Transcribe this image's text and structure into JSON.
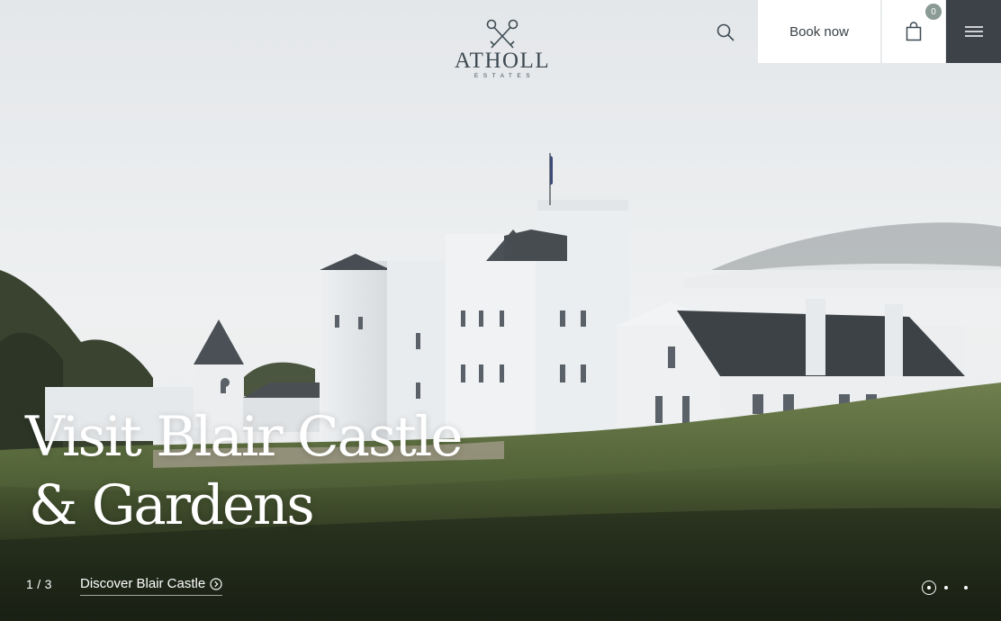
{
  "brand": {
    "name": "ATHOLL",
    "sub": "ESTATES"
  },
  "header": {
    "search_icon": "search-icon",
    "book_label": "Book now",
    "cart_icon": "shopping-bag-icon",
    "cart_count": "0",
    "menu_icon": "hamburger-menu-icon"
  },
  "hero": {
    "title_line1": "Visit Blair Castle",
    "title_line2": "& Gardens",
    "slide_counter": "1 / 3",
    "link_label": "Discover Blair Castle",
    "link_icon": "circle-chevron-right-icon",
    "slides_total": 3,
    "active_slide": 1
  },
  "colors": {
    "menu_bg": "#3c4248",
    "logo": "#3d4a52",
    "text_light": "#ffffff"
  }
}
